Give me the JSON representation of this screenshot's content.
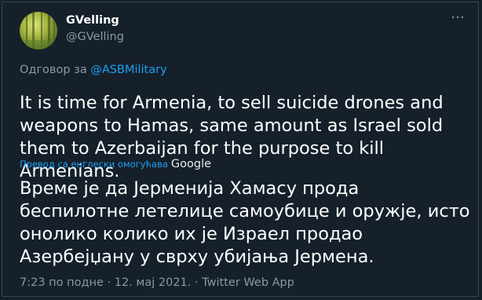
{
  "colors": {
    "background": "#15202b",
    "primary_text": "#ffffff",
    "secondary_text": "#8899a6",
    "link": "#1da1f2",
    "border": "#38444d"
  },
  "tweet": {
    "author": {
      "display_name": "GVelling",
      "handle": "@GVelling",
      "avatar_icon": "forest-avatar"
    },
    "more_icon": "ellipsis-icon",
    "more_glyph": "···",
    "reply_prefix": "Одговор за",
    "reply_to": "@ASBMilitary",
    "text": "It is time for Armenia, to sell suicide drones and weapons to Hamas, same amount as Israel sold them to Azerbaijan for the purpose to kill Armenians.",
    "translation": {
      "link_label": "Превод са енглески омогућава",
      "provider": "Google",
      "text": "Време је да Јерменија Хамасу прода беспилотне летелице самоубице и оружје, исто онолико колико их је Израел продао Азербејџану у сврху убијања Јермена."
    },
    "meta": "7:23 по подне · 12. мај 2021. · Twitter Web App"
  }
}
